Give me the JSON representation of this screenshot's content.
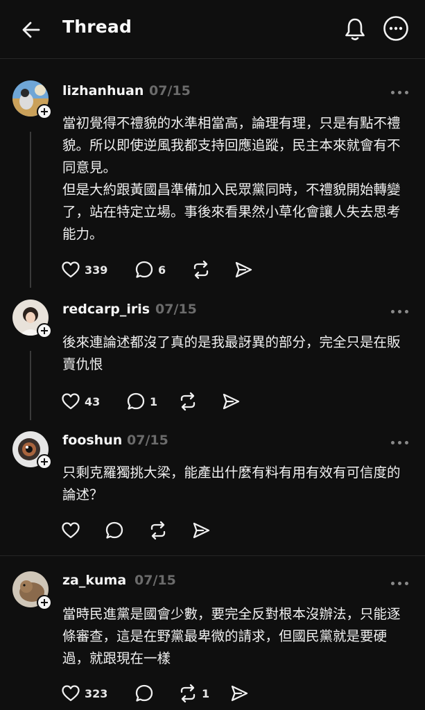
{
  "header": {
    "title": "Thread"
  },
  "posts": [
    {
      "username": "lizhanhuan",
      "date": "07/15",
      "text": "當初覺得不禮貌的水準相當高，論理有理，只是有點不禮貌。所以即使逆風我都支持回應追蹤，民主本來就會有不同意見。\n但是大約跟黃國昌準備加入民眾黨同時，不禮貌開始轉變了，站在特定立場。事後來看果然小草化會讓人失去思考能力。",
      "likes": "339",
      "replies": "6",
      "reposts": ""
    },
    {
      "username": "redcarp_iris",
      "date": "07/15",
      "text": "後來連論述都沒了真的是我最訝異的部分，完全只是在販賣仇恨",
      "likes": "43",
      "replies": "1",
      "reposts": ""
    },
    {
      "username": "fooshun",
      "date": "07/15",
      "text": "只剩克羅獨挑大梁，能產出什麼有料有用有效有可信度的論述？",
      "likes": "",
      "replies": "",
      "reposts": ""
    },
    {
      "username": "za_kuma",
      "date": "07/15",
      "text": "當時民進黨是國會少數，要完全反對根本沒辦法，只能逐條審查，這是在野黨最卑微的請求，但國民黨就是要硬過，就跟現在一樣",
      "likes": "323",
      "replies": "",
      "reposts": "1"
    }
  ],
  "icons": {
    "back": "arrow-left-icon",
    "bell": "bell-icon",
    "more": "more-horizontal-icon",
    "like": "heart-icon",
    "reply": "comment-icon",
    "repost": "repost-icon",
    "share": "send-icon"
  }
}
